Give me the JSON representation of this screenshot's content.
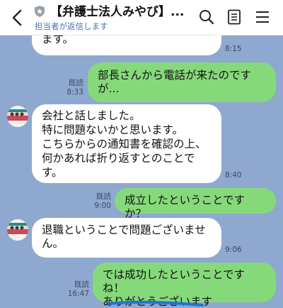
{
  "header": {
    "title": "【弁護士法人みやび】...",
    "subtitle": "担当者が返信します"
  },
  "messages": [
    {
      "direction": "in",
      "text": "ます。",
      "time": "8:15"
    },
    {
      "direction": "out",
      "text": "部長さんから電話が来たのです\nが...",
      "read": "既読",
      "time": "8:33"
    },
    {
      "direction": "in",
      "text": "会社と話しました。\n特に問題ないかと思います。\nこちらからの通知書を確認の上、\n何かあれば折り返すとのことで\nす。",
      "time": "8:40"
    },
    {
      "direction": "out",
      "text": "成立したということですか？",
      "read": "既読",
      "time": "9:00"
    },
    {
      "direction": "in",
      "text": "退職ということで問題ございませ\nん。",
      "time": "9:06"
    },
    {
      "direction": "out",
      "text": "では成功したということですね！\nありがとうございます",
      "read": "既読",
      "time": "16:47"
    }
  ],
  "colors": {
    "background": "#8fa8cf",
    "incoming_bubble": "#ffffff",
    "outgoing_bubble": "#86d97a",
    "subtitle": "#4a72b8"
  }
}
